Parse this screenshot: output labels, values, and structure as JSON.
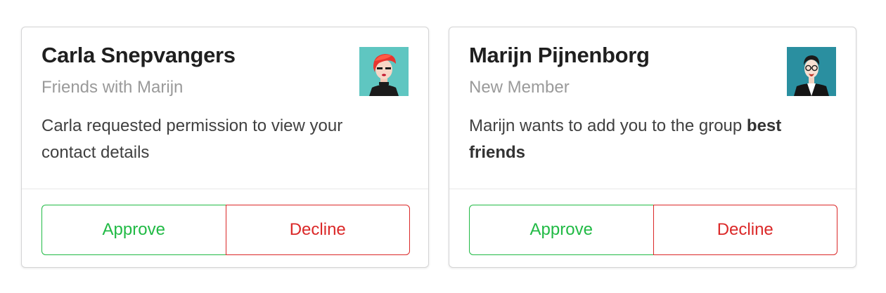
{
  "cards": [
    {
      "name": "Carla Snepvangers",
      "meta": "Friends with Marijn",
      "description": "Carla requested permission to view your contact details",
      "avatar_icon": "avatar-woman-red-hair",
      "approve_label": "Approve",
      "decline_label": "Decline"
    },
    {
      "name": "Marijn Pijnenborg",
      "meta": "New Member",
      "description_prefix": "Marijn wants to add you to the group ",
      "description_group": "best friends",
      "avatar_icon": "avatar-man-glasses",
      "approve_label": "Approve",
      "decline_label": "Decline"
    }
  ],
  "colors": {
    "approve": "#21ba45",
    "decline": "#db2828",
    "meta_text": "#9a9a9a",
    "card_border": "#d4d4d5"
  }
}
